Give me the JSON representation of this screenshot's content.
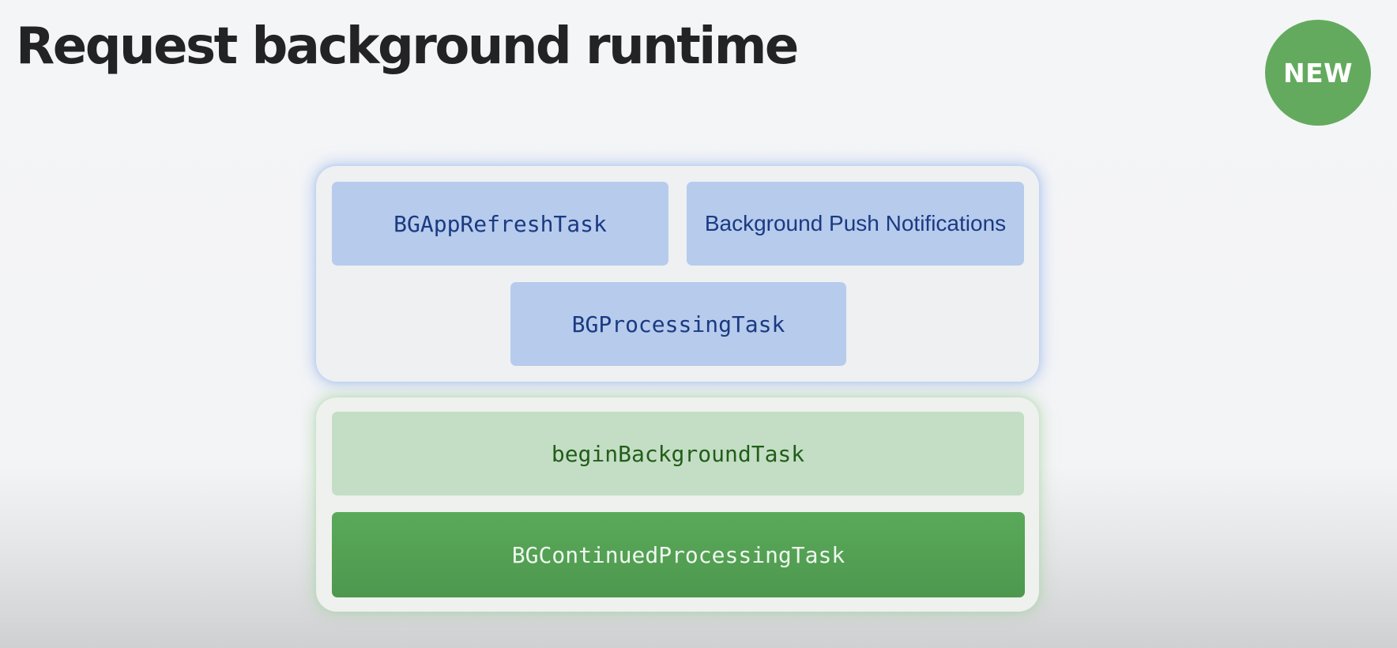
{
  "slide": {
    "title": "Request background runtime",
    "badge": "NEW"
  },
  "diagram": {
    "top_group": {
      "items": [
        {
          "label": "BGAppRefreshTask"
        },
        {
          "label": "Background Push Notifications"
        },
        {
          "label": "BGProcessingTask"
        }
      ]
    },
    "bottom_group": {
      "items": [
        {
          "label": "beginBackgroundTask"
        },
        {
          "label": "BGContinuedProcessingTask"
        }
      ]
    }
  },
  "colors": {
    "badge": "#63aa5e",
    "blue_box": "#b7cbec",
    "blue_text": "#1a3a82",
    "light_green_box": "#c4dec6",
    "light_green_text": "#225e18",
    "dark_green_box": "#53a053",
    "dark_green_text": "#eef7ee"
  }
}
